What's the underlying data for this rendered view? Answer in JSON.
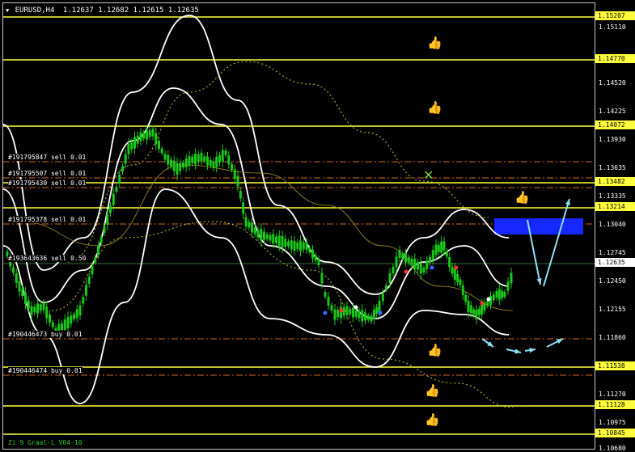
{
  "header": {
    "symbol_timeframe": "EURUSD,H4",
    "ohlc": "1.12637 1.12682 1.12615 1.12635"
  },
  "indicator_label": "Zi 9 Graal-L V04-10",
  "price_axis": {
    "ticks": [
      "1.15110",
      "1.14520",
      "1.14225",
      "1.13930",
      "1.13635",
      "1.13335",
      "1.13040",
      "1.12745",
      "1.12450",
      "1.12155",
      "1.11860",
      "1.11270",
      "1.10975",
      "1.10680"
    ],
    "level_tags": [
      "1.15207",
      "1.14770",
      "1.14072",
      "1.13482",
      "1.13214",
      "1.11538",
      "1.11128",
      "1.10845"
    ],
    "current_price": "1.12635"
  },
  "orders": [
    {
      "label": "#191795847 sell 0.01"
    },
    {
      "label": "#191795507 sell 0.01"
    },
    {
      "label": "#191795430 sell 0.01"
    },
    {
      "label": "#191795378 sell 0.01"
    },
    {
      "label": "#193643636 sell 0.50"
    },
    {
      "label": "#190446473 buy 0.01"
    },
    {
      "label": "#190446474 buy 0.01"
    }
  ],
  "markers": {
    "thumb_icon": "thumbs-up-icon",
    "cross_icon": "cross-icon"
  },
  "colors": {
    "background": "#000000",
    "level_line": "#ffff3c",
    "order_line": "#d2691e",
    "candle": "#19c819",
    "band": "#ffffff",
    "ma_dotted": "#c8c832",
    "zone": "#1428ff",
    "forecast_arrow": "#8fe1f5"
  }
}
